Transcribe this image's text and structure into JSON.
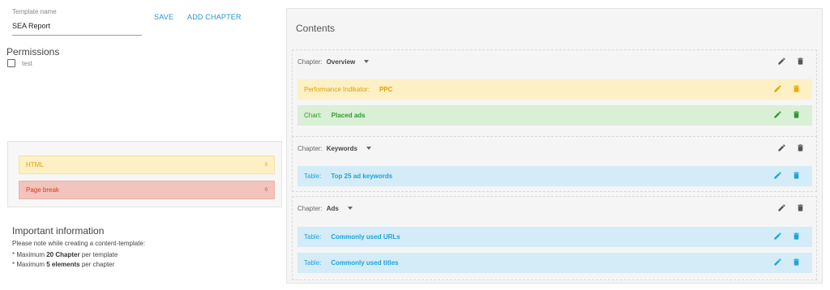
{
  "template": {
    "name_label": "Template name",
    "name_value": "SEA Report",
    "save_label": "SAVE",
    "add_chapter_label": "ADD CHAPTER"
  },
  "permissions": {
    "title": "Permissions",
    "items": [
      {
        "label": "test",
        "checked": false
      }
    ]
  },
  "elements": [
    {
      "label": "HTML",
      "count": "0",
      "color": "#e0a000"
    },
    {
      "label": "Page break",
      "count": "0",
      "color": "#d93a1e"
    }
  ],
  "info": {
    "title": "Important information",
    "note": "Please note while creating a content-template:",
    "max_chapters": {
      "prefix": "* Maximum ",
      "value": "20 Chapter",
      "suffix": " per template"
    },
    "max_elements": {
      "prefix": "* Maximum ",
      "value": "5 elements",
      "suffix": " per chapter"
    }
  },
  "contents": {
    "title": "Contents",
    "chapter_prefix": "Chapter:",
    "chapters": [
      {
        "name": "Overview",
        "items": [
          {
            "type": "Performance Indikator:",
            "name": "PPC",
            "style": "yellow"
          },
          {
            "type": "Chart:",
            "name": "Placed ads",
            "style": "green"
          }
        ]
      },
      {
        "name": "Keywords",
        "items": [
          {
            "type": "Table:",
            "name": "Top 25 ad keywords",
            "style": "blue"
          }
        ]
      },
      {
        "name": "Ads",
        "items": [
          {
            "type": "Table:",
            "name": "Commonly used URLs",
            "style": "blue"
          },
          {
            "type": "Table:",
            "name": "Commonly used titles",
            "style": "blue"
          }
        ]
      }
    ]
  },
  "colors": {
    "link": "#2196d3",
    "yellow": "#e0a000",
    "green": "#2e9a2e",
    "blue": "#1ca3dc",
    "red": "#d93a1e"
  },
  "icons": [
    "edit-icon",
    "delete-icon",
    "chevron-down-icon",
    "checkbox-icon"
  ]
}
